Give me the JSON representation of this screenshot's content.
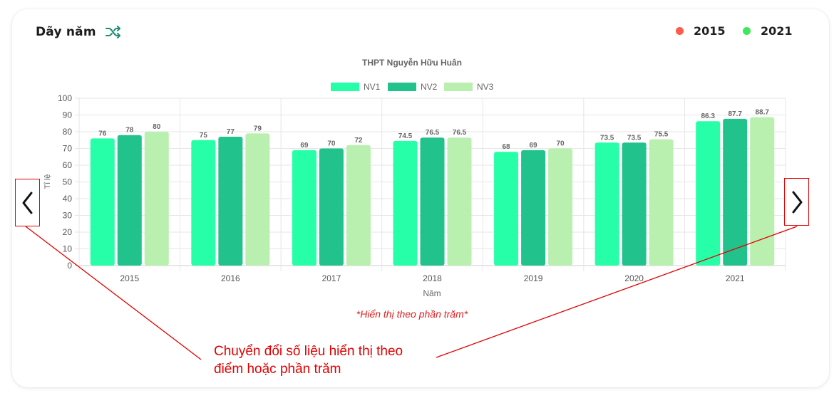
{
  "header": {
    "title": "Dãy năm",
    "shuffle_icon": "shuffle-icon",
    "year_legend": [
      {
        "label": "2015",
        "color": "#ff5a4a"
      },
      {
        "label": "2021",
        "color": "#3ee858"
      }
    ]
  },
  "chart_data": {
    "type": "bar",
    "title": "THPT Nguyễn Hữu Huân",
    "xlabel": "Năm",
    "ylabel": "Tỉ lệ",
    "ylim": [
      0,
      100
    ],
    "yticks": [
      0,
      10,
      20,
      30,
      40,
      50,
      60,
      70,
      80,
      90,
      100
    ],
    "categories": [
      "2015",
      "2016",
      "2017",
      "2018",
      "2019",
      "2020",
      "2021"
    ],
    "grid": true,
    "legend_position": "top-center",
    "series": [
      {
        "name": "NV1",
        "color": "#27ffa8",
        "values": [
          76,
          75,
          69,
          74.5,
          68,
          73.5,
          86.3
        ]
      },
      {
        "name": "NV2",
        "color": "#22c28c",
        "values": [
          78,
          77,
          70,
          76.5,
          69,
          73.5,
          87.7
        ]
      },
      {
        "name": "NV3",
        "color": "#b9f0b0",
        "values": [
          80,
          79,
          72,
          76.5,
          70,
          75.5,
          88.7
        ]
      }
    ],
    "footnote": "*Hiển thị theo phần trăm*"
  },
  "nav": {
    "prev_icon": "chevron-left-icon",
    "next_icon": "chevron-right-icon"
  },
  "annotation": {
    "lines": [
      "Chuyển đổi số liệu hiển thị theo",
      "điểm hoặc phần trăm"
    ],
    "color": "#e30000"
  }
}
